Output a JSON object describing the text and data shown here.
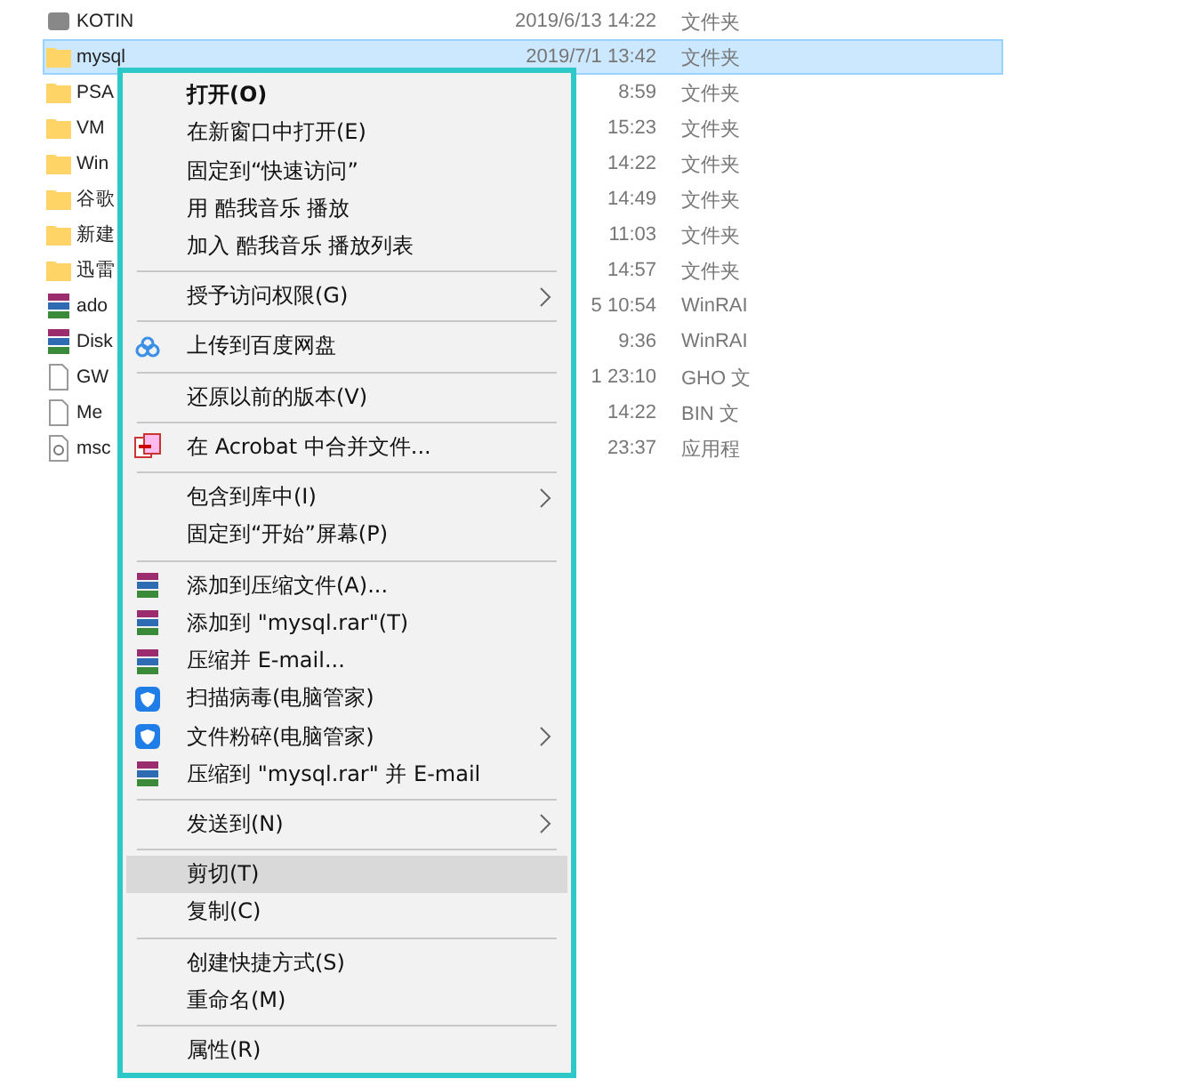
{
  "file_list": {
    "rows": [
      {
        "kind": "app",
        "name": "KOTIN",
        "date": "2019/6/13 14:22",
        "type": "文件夹",
        "selected": false
      },
      {
        "kind": "folder",
        "name": "mysql",
        "date": "2019/7/1 13:42",
        "type": "文件夹",
        "selected": true
      },
      {
        "kind": "folder",
        "name": "PSA",
        "date": "8:59",
        "type": "文件夹",
        "selected": false
      },
      {
        "kind": "folder",
        "name": "VM",
        "date": "15:23",
        "type": "文件夹",
        "selected": false
      },
      {
        "kind": "folder",
        "name": "Win",
        "date": "14:22",
        "type": "文件夹",
        "selected": false
      },
      {
        "kind": "folder",
        "name": "谷歌",
        "date": "14:49",
        "type": "文件夹",
        "selected": false
      },
      {
        "kind": "folder",
        "name": "新建",
        "date": "11:03",
        "type": "文件夹",
        "selected": false
      },
      {
        "kind": "folder",
        "name": "迅雷",
        "date": "14:57",
        "type": "文件夹",
        "selected": false
      },
      {
        "kind": "archive",
        "name": "ado",
        "date": "5 10:54",
        "type": "WinRAI",
        "selected": false
      },
      {
        "kind": "archive",
        "name": "Disk",
        "date": "9:36",
        "type": "WinRAI",
        "selected": false
      },
      {
        "kind": "document",
        "name": "GW",
        "date": "1 23:10",
        "type": "GHO 文",
        "selected": false
      },
      {
        "kind": "document",
        "name": "Me",
        "date": "14:22",
        "type": "BIN 文",
        "selected": false
      },
      {
        "kind": "setup",
        "name": "msc",
        "date": "23:37",
        "type": "应用程",
        "selected": false
      }
    ]
  },
  "context_menu": {
    "items": [
      {
        "kind": "plain",
        "label": "打开(O)",
        "bold": true,
        "selected": false
      },
      {
        "kind": "plain",
        "label": "在新窗口中打开(E)",
        "selected": false
      },
      {
        "kind": "plain",
        "label": "固定到“快速访问”",
        "selected": false
      },
      {
        "kind": "plain",
        "label": "用 酷我音乐 播放",
        "selected": false
      },
      {
        "kind": "plain",
        "label": "加入 酷我音乐 播放列表",
        "selected": false
      },
      {
        "kind": "separator"
      },
      {
        "kind": "plain",
        "label": "授予访问权限(G)",
        "submenu": true,
        "selected": false
      },
      {
        "kind": "separator"
      },
      {
        "kind": "cloud",
        "label": "上传到百度网盘",
        "selected": false
      },
      {
        "kind": "separator"
      },
      {
        "kind": "plain",
        "label": "还原以前的版本(V)",
        "selected": false
      },
      {
        "kind": "separator"
      },
      {
        "kind": "acrobat",
        "label": "在 Acrobat 中合并文件...",
        "selected": false
      },
      {
        "kind": "separator"
      },
      {
        "kind": "plain",
        "label": "包含到库中(I)",
        "submenu": true,
        "selected": false
      },
      {
        "kind": "plain",
        "label": "固定到“开始”屏幕(P)",
        "selected": false
      },
      {
        "kind": "separator"
      },
      {
        "kind": "archive",
        "label": "添加到压缩文件(A)...",
        "selected": false
      },
      {
        "kind": "archive",
        "label": "添加到 \"mysql.rar\"(T)",
        "selected": false
      },
      {
        "kind": "archive",
        "label": "压缩并 E-mail...",
        "selected": false
      },
      {
        "kind": "shield",
        "label": "扫描病毒(电脑管家)",
        "selected": false
      },
      {
        "kind": "shield",
        "label": "文件粉碎(电脑管家)",
        "submenu": true,
        "selected": false
      },
      {
        "kind": "archive",
        "label": "压缩到 \"mysql.rar\" 并 E-mail",
        "selected": false
      },
      {
        "kind": "separator"
      },
      {
        "kind": "plain",
        "label": "发送到(N)",
        "submenu": true,
        "selected": false
      },
      {
        "kind": "separator"
      },
      {
        "kind": "plain",
        "label": "剪切(T)",
        "selected": true
      },
      {
        "kind": "plain",
        "label": "复制(C)",
        "selected": false
      },
      {
        "kind": "separator"
      },
      {
        "kind": "plain",
        "label": "创建快捷方式(S)",
        "selected": false
      },
      {
        "kind": "plain",
        "label": "重命名(M)",
        "selected": false
      },
      {
        "kind": "separator"
      },
      {
        "kind": "plain",
        "label": "属性(R)",
        "selected": false
      }
    ]
  }
}
